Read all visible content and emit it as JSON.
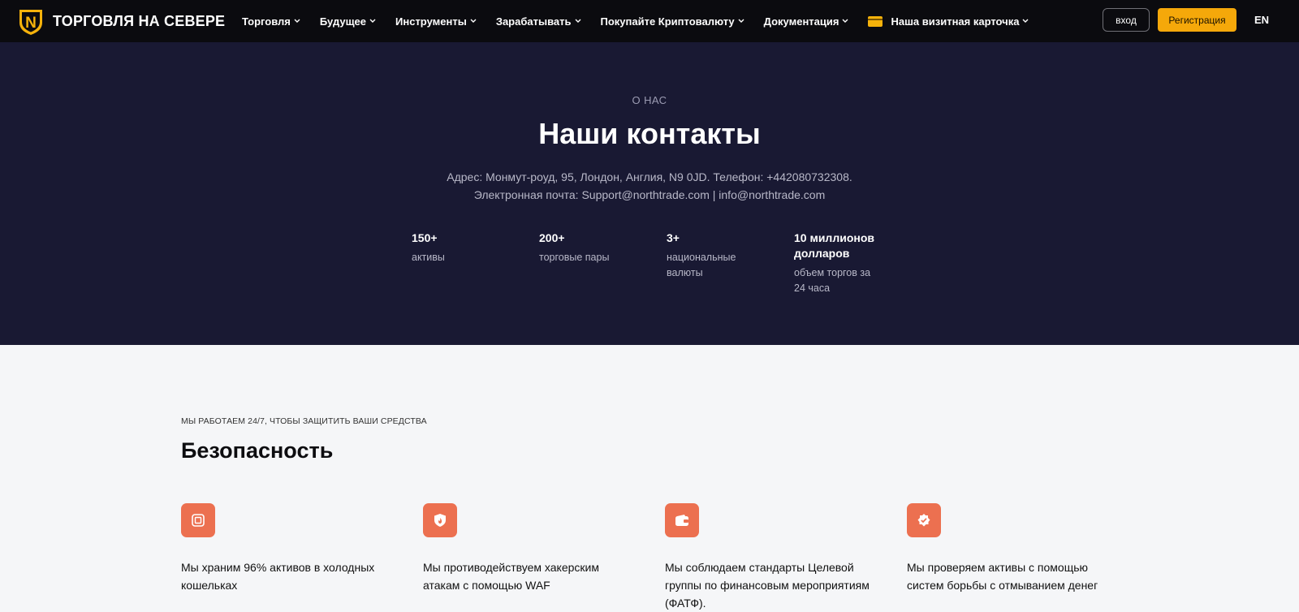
{
  "nav": {
    "brand": "ТОРГОВЛЯ НА СЕВЕРЕ",
    "brand_letter": "N",
    "items": [
      {
        "label": "Торговля"
      },
      {
        "label": "Будущее"
      },
      {
        "label": "Инструменты"
      },
      {
        "label": "Зарабатывать"
      },
      {
        "label": "Покупайте Криптовалюту"
      },
      {
        "label": "Документация"
      },
      {
        "label": "Наша визитная карточка"
      }
    ],
    "login_label": "вход",
    "register_label": "Регистрация",
    "lang": "EN"
  },
  "hero": {
    "eyebrow": "О НАС",
    "title": "Наши контакты",
    "address_line1": "Адрес: Монмут-роуд, 95, Лондон, Англия, N9 0JD. Телефон: +442080732308.",
    "address_line2": "Электронная почта: Support@northtrade.com | info@northtrade.com",
    "stats": [
      {
        "value": "150+",
        "label": "активы"
      },
      {
        "value": "200+",
        "label": "торговые пары"
      },
      {
        "value": "3+",
        "label": "национальные валюты"
      },
      {
        "value": "10 миллионов долларов",
        "label": "объем торгов за 24 часа"
      }
    ]
  },
  "security": {
    "eyebrow": "МЫ РАБОТАЕМ 24/7, ЧТОБЫ ЗАЩИТИТЬ ВАШИ СРЕДСТВА",
    "title": "Безопасность",
    "features": [
      {
        "icon": "cold-wallet-icon",
        "text": "Мы храним 96% активов в холодных кошельках"
      },
      {
        "icon": "shield-fire-icon",
        "text": "Мы противодействуем хакерским атакам с помощью WAF"
      },
      {
        "icon": "wallet-icon",
        "text": "Мы соблюдаем стандарты Целевой группы по финансовым мероприятиям (ФАТФ)."
      },
      {
        "icon": "verified-badge-icon",
        "text": "Мы проверяем активы с помощью систем борьбы с отмыванием денег"
      }
    ]
  },
  "colors": {
    "nav_bg": "#0b0b0f",
    "hero_bg": "#191933",
    "accent": "#f5a80a",
    "feature_icon_bg": "#ec7050"
  }
}
